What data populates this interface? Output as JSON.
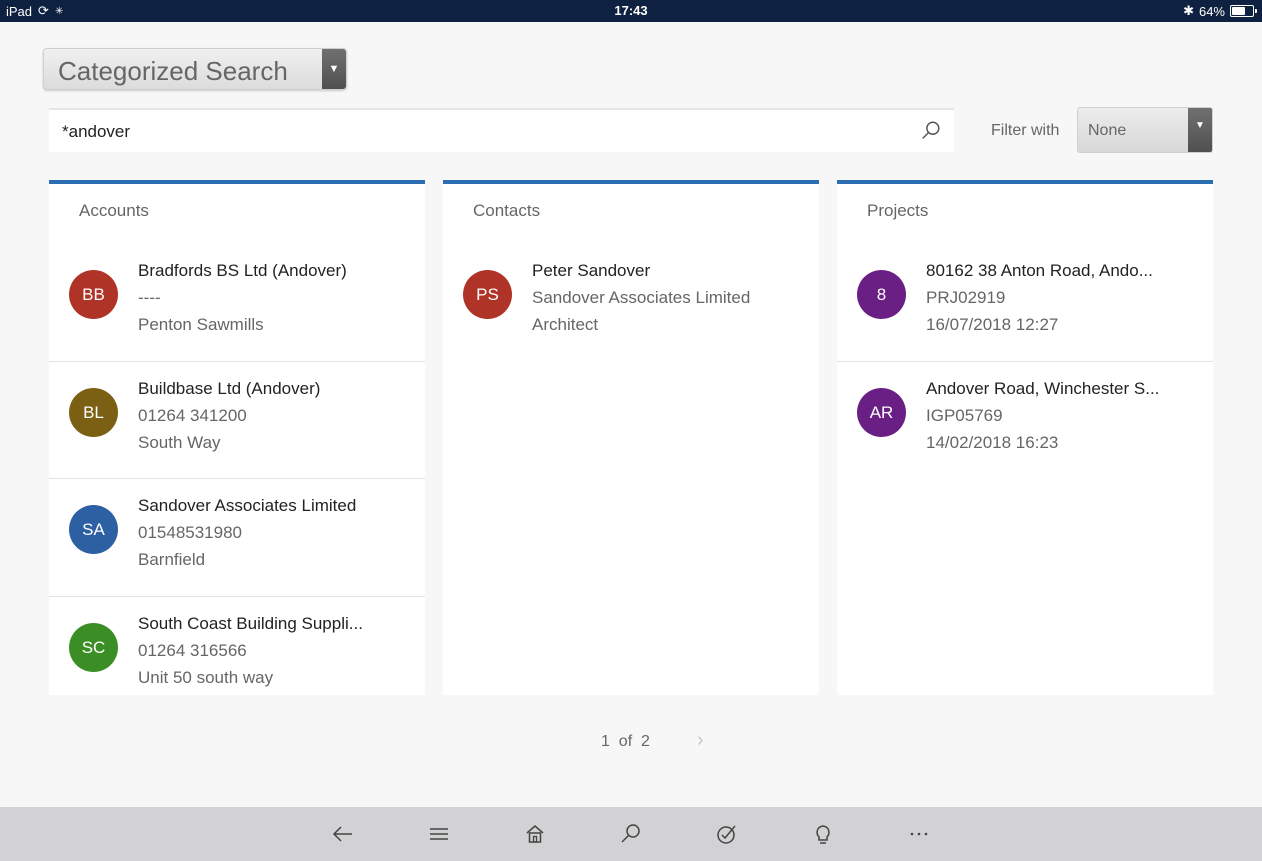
{
  "status_bar": {
    "device": "iPad",
    "time": "17:43",
    "battery": "64%",
    "battery_level": 0.64
  },
  "category": {
    "label": "Categorized Search"
  },
  "search": {
    "value": "*andover"
  },
  "filter": {
    "label": "Filter with",
    "value": "None"
  },
  "columns": [
    {
      "title": "Accounts",
      "rows": [
        {
          "initials": "BB",
          "color": "#b03327",
          "line1": "Bradfords BS Ltd (Andover)",
          "line2": "----",
          "line3": "Penton Sawmills"
        },
        {
          "initials": "BL",
          "color": "#7b5f12",
          "line1": "Buildbase Ltd (Andover)",
          "line2": "01264 341200",
          "line3": "South Way"
        },
        {
          "initials": "SA",
          "color": "#2d5fa3",
          "line1": "Sandover Associates Limited",
          "line2": "01548531980",
          "line3": "Barnfield"
        },
        {
          "initials": "SC",
          "color": "#3b8e26",
          "line1": "South Coast Building Suppli...",
          "line2": "01264 316566",
          "line3": "Unit 50 south way"
        }
      ]
    },
    {
      "title": "Contacts",
      "rows": [
        {
          "initials": "PS",
          "color": "#b03327",
          "line1": "Peter Sandover",
          "line2": "Sandover Associates Limited",
          "line3": "Architect"
        }
      ]
    },
    {
      "title": "Projects",
      "rows": [
        {
          "initials": "8",
          "color": "#6a1f84",
          "line1": "80162 38 Anton Road, Ando...",
          "line2": "PRJ02919",
          "line3": "16/07/2018 12:27"
        },
        {
          "initials": "AR",
          "color": "#6a1f84",
          "line1": "Andover Road, Winchester S...",
          "line2": "IGP05769",
          "line3": "14/02/2018 16:23"
        }
      ]
    }
  ],
  "pagination": {
    "current": "1",
    "of": "of",
    "total": "2"
  },
  "nav_icons": [
    "back-icon",
    "menu-icon",
    "home-icon",
    "search-icon",
    "task-icon",
    "lightbulb-icon",
    "more-icon"
  ]
}
